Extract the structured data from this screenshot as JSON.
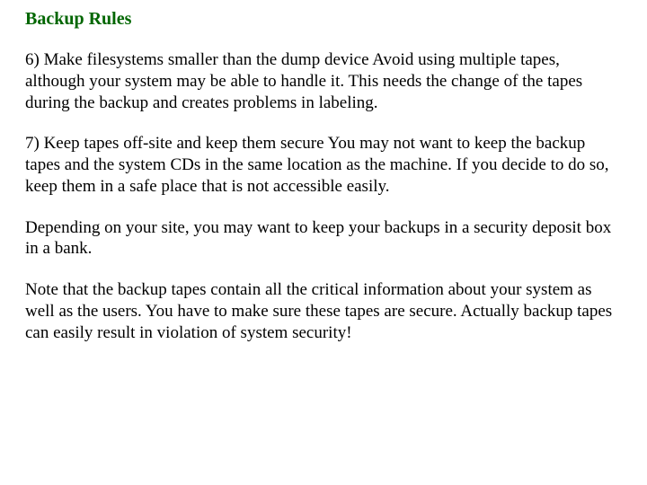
{
  "title": "Backup Rules",
  "paragraphs": {
    "p1": "6) Make filesystems smaller than the dump device\nAvoid using multiple tapes, although your system may be able to handle it.  This needs the change of the tapes during the backup and creates problems in labeling.",
    "p2": "7) Keep tapes off-site and keep them secure\nYou may not want to keep the backup tapes and the system CDs in the same location as the machine.  If you decide to do so, keep them in a safe place that is not accessible easily.",
    "p3": "Depending on your site, you may want to keep your backups in a security deposit box in a bank.",
    "p4": "Note that the backup tapes contain all the critical information about your system as well as the users.   You have to make sure these tapes are secure.  Actually backup tapes can easily result in violation of system security!"
  }
}
